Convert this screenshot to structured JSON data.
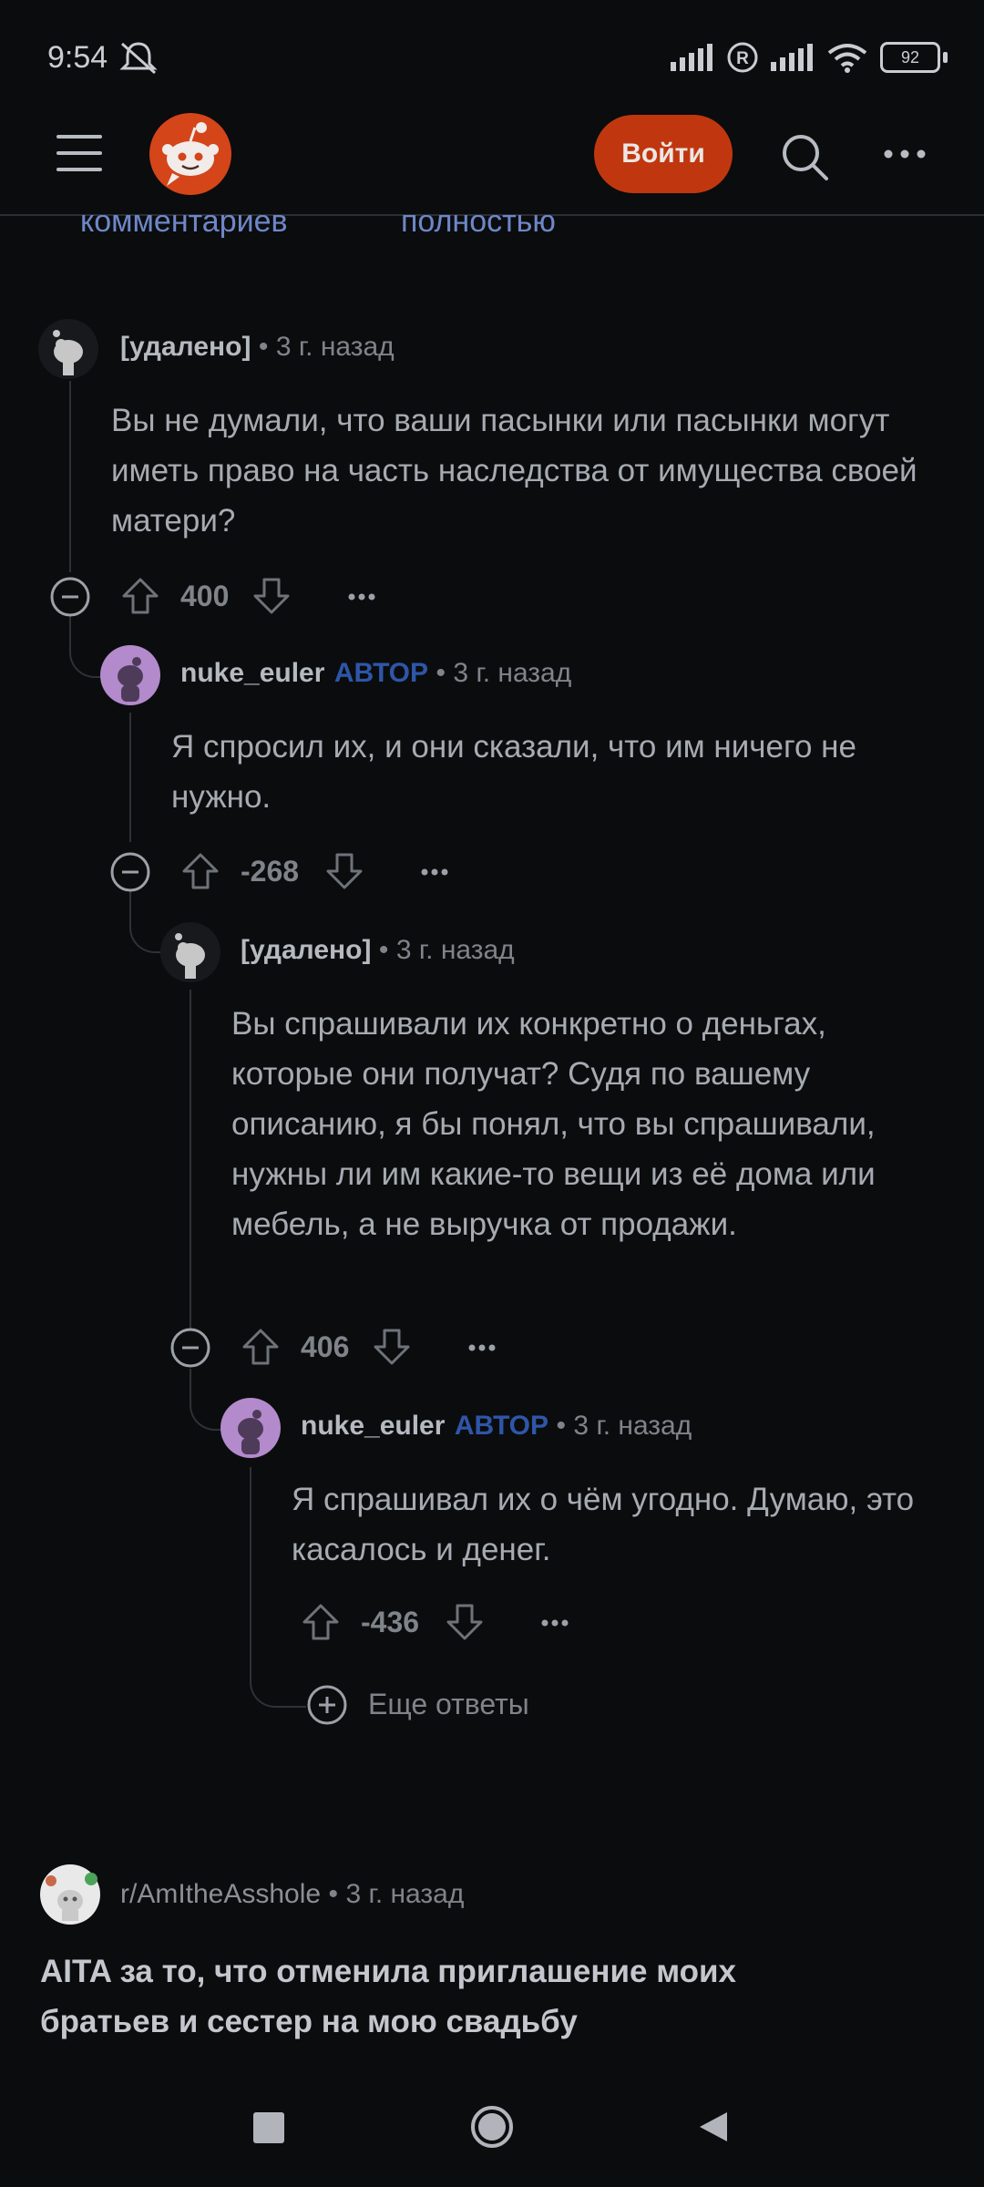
{
  "status_bar": {
    "time": "9:54",
    "battery": "92"
  },
  "header": {
    "login_label": "Войти"
  },
  "truncated_links": {
    "left": "комментариев",
    "right": "полностью"
  },
  "comments": [
    {
      "username": "[удалено]",
      "author_tag": "",
      "sep": "•",
      "time": "3 г. назад",
      "body": "Вы не думали, что ваши пасынки или пасынки могут иметь право на часть наследства от имущества своей матери?",
      "votes": "400"
    },
    {
      "username": "nuke_euler",
      "author_tag": "АВТОР",
      "sep": "•",
      "time": "3 г. назад",
      "body": "Я спросил их, и они сказали, что им ничего не нужно.",
      "votes": "-268"
    },
    {
      "username": "[удалено]",
      "author_tag": "",
      "sep": "•",
      "time": "3 г. назад",
      "body": "Вы спрашивали их конкретно о деньгах, которые они получат? Судя по вашему описанию, я бы понял, что вы спрашивали, нужны ли им какие-то вещи из её дома или мебель, а не выручка от продажи.",
      "votes": "406"
    },
    {
      "username": "nuke_euler",
      "author_tag": "АВТОР",
      "sep": "•",
      "time": "3 г. назад",
      "body": "Я спрашивал их о чём угодно. Думаю, это касалось и денег.",
      "votes": "-436"
    }
  ],
  "more_replies": "Еще ответы",
  "related_post": {
    "subreddit": "r/AmItheAsshole",
    "sep": "•",
    "time": "3 г. назад",
    "title": "AITA за то, что отменила приглашение моих братьев и сестер на мою свадьбу"
  },
  "colors": {
    "background": "#0b0c0e",
    "login_button": "#c0370f",
    "author_tag": "#2e56a8",
    "link": "#6e87c8"
  },
  "icons": [
    "hamburger-menu-icon",
    "reddit-logo-icon",
    "search-icon",
    "more-icon",
    "collapse-icon",
    "upvote-icon",
    "downvote-icon",
    "plus-icon",
    "square-icon",
    "circle-icon",
    "back-icon"
  ]
}
